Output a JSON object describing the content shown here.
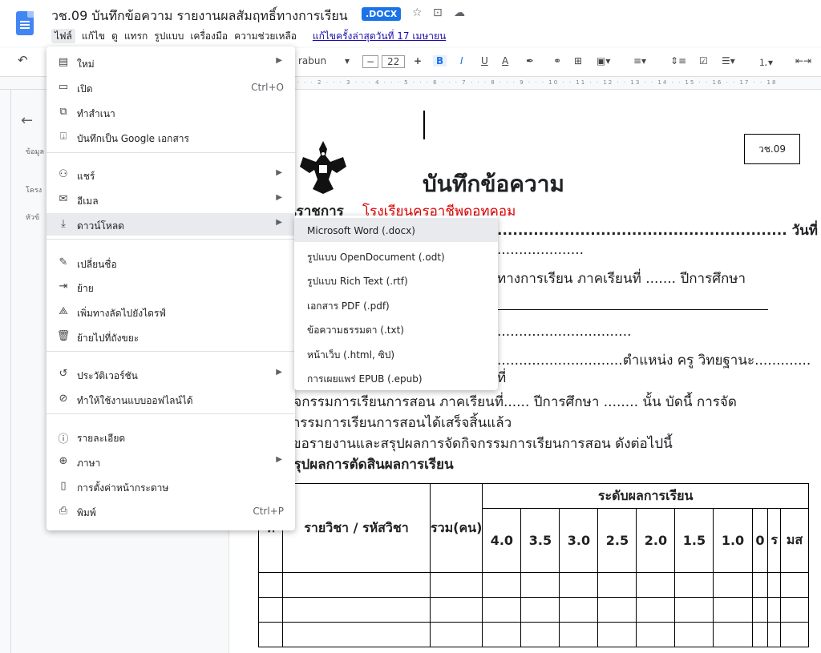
{
  "header": {
    "doc_title": "วช.09 บันทึกข้อความ รายงานผลสัมฤทธิ์ทางการเรียน",
    "badge": ".DOCX",
    "star_icon": "star-icon",
    "move_icon": "folder-move-icon",
    "cloud_icon": "cloud-status-icon"
  },
  "menubar": {
    "items": [
      "ไฟล์",
      "แก้ไข",
      "ดู",
      "แทรก",
      "รูปแบบ",
      "เครื่องมือ",
      "ความช่วยเหลือ"
    ],
    "last_edit": "แก้ไขครั้งล่าสุดวันที่ 17 เมษายน"
  },
  "toolbar": {
    "undo": "↶",
    "font": "rabun",
    "font_size": "22",
    "minus": "−",
    "plus": "+",
    "bold": "B",
    "italic": "I",
    "underline": "U",
    "text_color": "A"
  },
  "ruler": {
    "marks": "1 · · · 2 · · · 3 · · · 4 · · · 5 · · · 6 · · · 7 · · · 8 · · · 9 · · · 10 · · 11 · · 12 · · 13 · · 14 · · 15 · · 16 · · 17 · · 18"
  },
  "outline": {
    "items": [
      "ข้อมูล",
      "โครง",
      "หัวข้"
    ]
  },
  "file_menu": {
    "items": [
      {
        "icon": "new-doc-icon",
        "glyph": "▤",
        "label": "ใหม่",
        "shortcut": "",
        "submenu": true
      },
      {
        "icon": "open-folder-icon",
        "glyph": "▭",
        "label": "เปิด",
        "shortcut": "Ctrl+O",
        "submenu": false
      },
      {
        "icon": "copy-icon",
        "glyph": "⧉",
        "label": "ทำสำเนา",
        "shortcut": "",
        "submenu": false
      },
      {
        "icon": "save-as-google-doc-icon",
        "glyph": "⍗",
        "label": "บันทึกเป็น Google เอกสาร",
        "shortcut": "",
        "submenu": false
      },
      {
        "icon": "share-icon",
        "glyph": "⚇",
        "label": "แชร์",
        "shortcut": "",
        "submenu": true
      },
      {
        "icon": "email-icon",
        "glyph": "✉",
        "label": "อีเมล",
        "shortcut": "",
        "submenu": true
      },
      {
        "icon": "download-icon",
        "glyph": "⤓",
        "label": "ดาวน์โหลด",
        "shortcut": "",
        "submenu": true
      },
      {
        "icon": "rename-icon",
        "glyph": "✎",
        "label": "เปลี่ยนชื่อ",
        "shortcut": "",
        "submenu": false
      },
      {
        "icon": "move-icon",
        "glyph": "⇥",
        "label": "ย้าย",
        "shortcut": "",
        "submenu": false
      },
      {
        "icon": "add-shortcut-drive-icon",
        "glyph": "⟁",
        "label": "เพิ่มทางลัดไปยังไดรฟ์",
        "shortcut": "",
        "submenu": false
      },
      {
        "icon": "trash-icon",
        "glyph": "🗑",
        "label": "ย้ายไปที่ถังขยะ",
        "shortcut": "",
        "submenu": false
      },
      {
        "icon": "version-history-icon",
        "glyph": "↺",
        "label": "ประวัติเวอร์ชัน",
        "shortcut": "",
        "submenu": true
      },
      {
        "icon": "offline-icon",
        "glyph": "⊘",
        "label": "ทำให้ใช้งานแบบออฟไลน์ได้",
        "shortcut": "",
        "submenu": false
      },
      {
        "icon": "details-icon",
        "glyph": "ⓘ",
        "label": "รายละเอียด",
        "shortcut": "",
        "submenu": false
      },
      {
        "icon": "language-icon",
        "glyph": "⊕",
        "label": "ภาษา",
        "shortcut": "",
        "submenu": true
      },
      {
        "icon": "page-setup-icon",
        "glyph": "▯",
        "label": "การตั้งค่าหน้ากระดาษ",
        "shortcut": "",
        "submenu": false
      },
      {
        "icon": "print-icon",
        "glyph": "⎙",
        "label": "พิมพ์",
        "shortcut": "Ctrl+P",
        "submenu": false
      }
    ]
  },
  "download_menu": {
    "items": [
      "Microsoft Word (.docx)",
      "รูปแบบ OpenDocument (.odt)",
      "รูปแบบ Rich Text (.rtf)",
      "เอกสาร PDF (.pdf)",
      "ข้อความธรรมดา (.txt)",
      "หน้าเว็บ (.html, ซิป)",
      "การเผยแพร่ EPUB (.epub)"
    ]
  },
  "document": {
    "doc_no": "วช.09",
    "memo_title": "บันทึกข้อความ",
    "agency_label": "นราชการ",
    "agency_value": "โรงเรียนครูอาชีพดอทคอม",
    "date_line": "........................................................ วันที่",
    "line2": "....................",
    "line3": "ทางการเรียน  ภาคเรียนที่ ....... ปีการศึกษา",
    "line4": "...............................",
    "line5": ".............................ตำแหน่ง ครู วิทยฐานะ.............",
    "line6": "ที่",
    "line7": "กิจกรรมการเรียนการสอน ภาคเรียนที่...... ปีการศึกษา ........ นั้น บัดนี้ การจัด",
    "line8": "กรรมการเรียนการสอนได้เสร็จสิ้นแล้ว",
    "line9": "ขอรายงานและสรุปผลการจัดกิจกรรมการเรียนการสอน ดังต่อไปนี้",
    "line10": "สรุปผลการตัดสินผลการเรียน",
    "table": {
      "col_no": "ที่",
      "col_subject": "รายวิชา / รหัสวิชา",
      "col_total": "รวม(คน)",
      "group_header": "ระดับผลการเรียน",
      "grades": [
        "4.0",
        "3.5",
        "3.0",
        "2.5",
        "2.0",
        "1.5",
        "1.0",
        "0",
        "ร",
        "มส"
      ]
    }
  }
}
